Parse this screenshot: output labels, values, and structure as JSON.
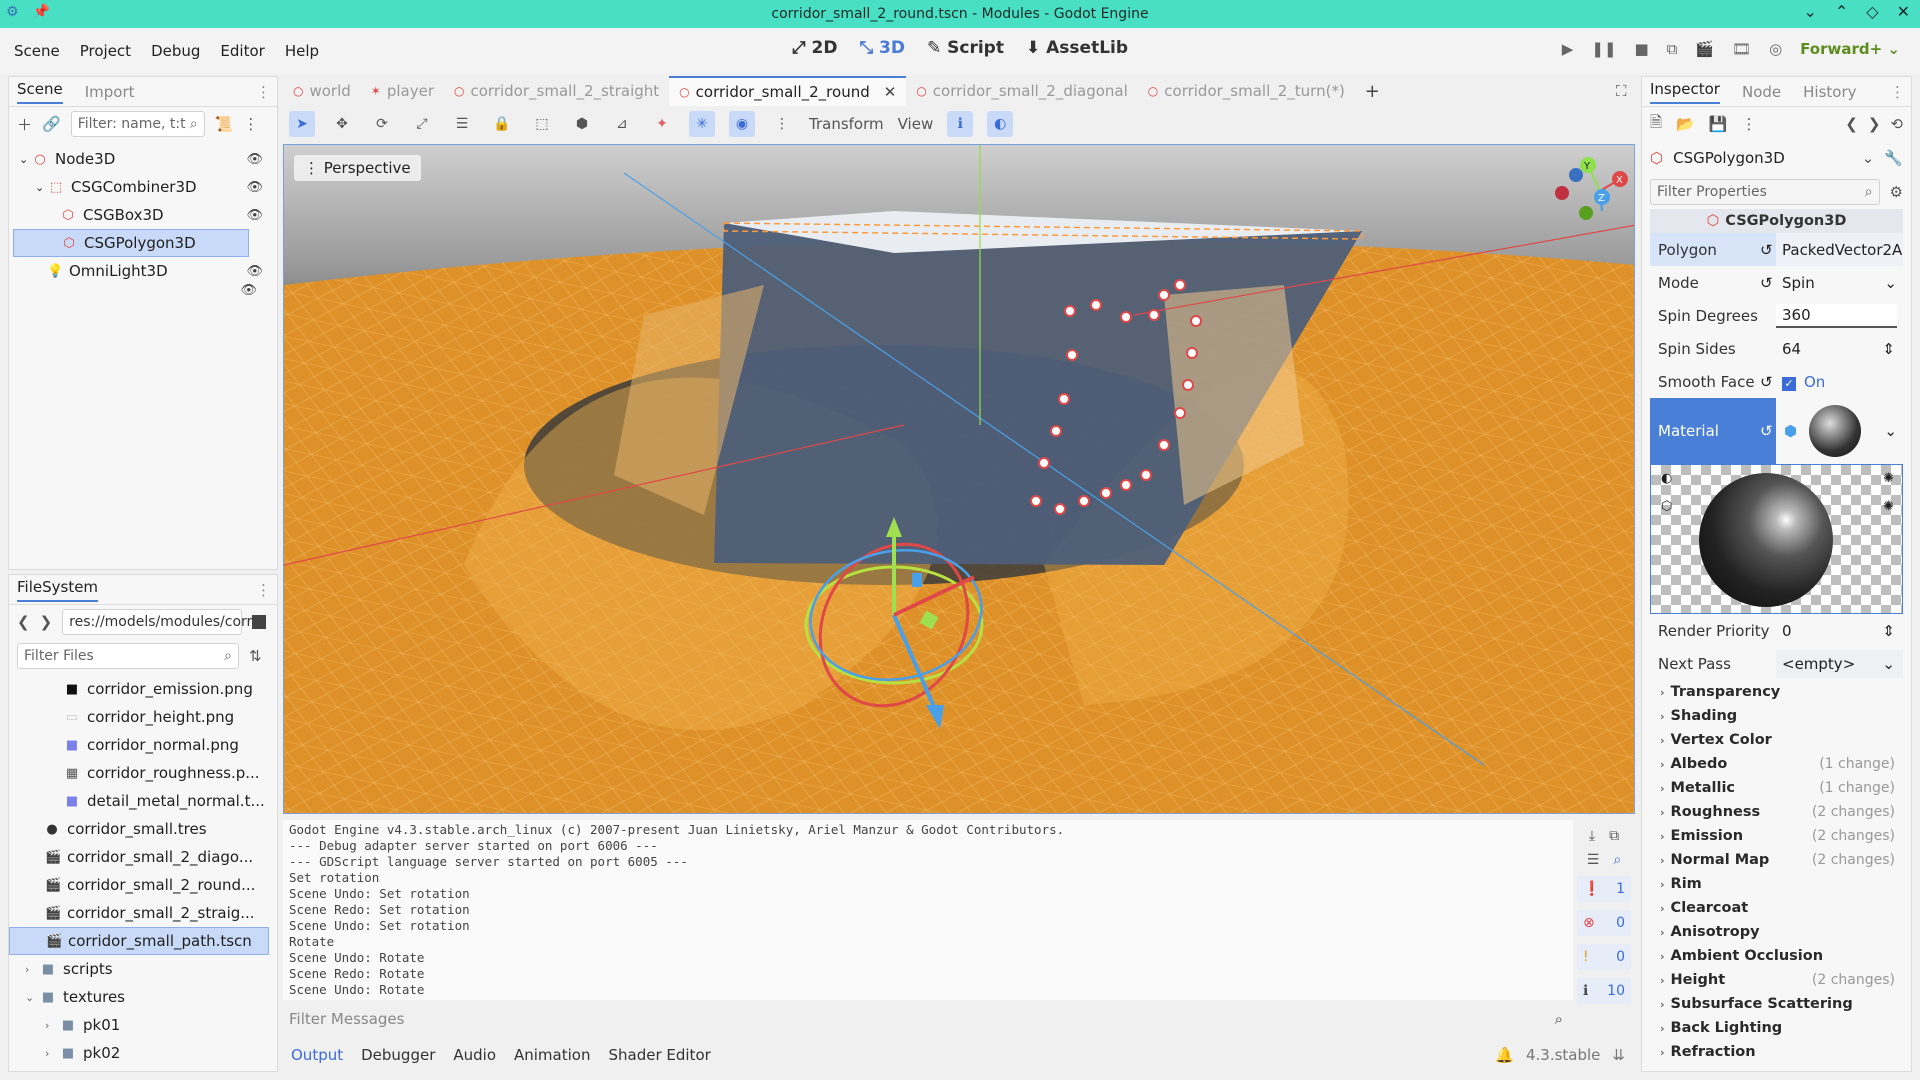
{
  "window": {
    "title": "corridor_small_2_round.tscn - Modules - Godot Engine",
    "controls": [
      "⌄",
      "⌃",
      "◇",
      "✕"
    ]
  },
  "menu": [
    "Scene",
    "Project",
    "Debug",
    "Editor",
    "Help"
  ],
  "workspaces": [
    {
      "label": "2D",
      "icon": "2d-icon"
    },
    {
      "label": "3D",
      "icon": "3d-icon"
    },
    {
      "label": "Script",
      "icon": "script-icon"
    },
    {
      "label": "AssetLib",
      "icon": "assetlib-icon"
    }
  ],
  "renderer": "Forward+",
  "scene_dock": {
    "tabs": [
      "Scene",
      "Import"
    ],
    "filter_placeholder": "Filter: name, t:t",
    "nodes": [
      {
        "label": "Node3D",
        "depth": 0
      },
      {
        "label": "CSGCombiner3D",
        "depth": 1
      },
      {
        "label": "CSGBox3D",
        "depth": 2
      },
      {
        "label": "CSGPolygon3D",
        "depth": 2,
        "selected": true
      },
      {
        "label": "OmniLight3D",
        "depth": 1
      }
    ]
  },
  "filesystem": {
    "tab": "FileSystem",
    "path": "res://models/modules/corri",
    "filter_placeholder": "Filter Files",
    "items": [
      {
        "label": "corridor_emission.png",
        "depth": 3,
        "icon": "black"
      },
      {
        "label": "corridor_height.png",
        "depth": 3,
        "icon": "white"
      },
      {
        "label": "corridor_normal.png",
        "depth": 3,
        "icon": "blue"
      },
      {
        "label": "corridor_roughness.p...",
        "depth": 3,
        "icon": "noise"
      },
      {
        "label": "detail_metal_normal.t...",
        "depth": 3,
        "icon": "blue"
      },
      {
        "label": "corridor_small.tres",
        "depth": 2,
        "icon": "sphere"
      },
      {
        "label": "corridor_small_2_diago...",
        "depth": 2,
        "icon": "scene"
      },
      {
        "label": "corridor_small_2_round...",
        "depth": 2,
        "icon": "scene"
      },
      {
        "label": "corridor_small_2_straig...",
        "depth": 2,
        "icon": "scene"
      },
      {
        "label": "corridor_small_path.tscn",
        "depth": 2,
        "icon": "scene",
        "selected": true
      },
      {
        "label": "scripts",
        "depth": 1,
        "icon": "folder"
      },
      {
        "label": "textures",
        "depth": 1,
        "icon": "folder",
        "open": true
      },
      {
        "label": "pk01",
        "depth": 2,
        "icon": "folder"
      },
      {
        "label": "pk02",
        "depth": 2,
        "icon": "folder"
      }
    ]
  },
  "editor_tabs": [
    {
      "label": "world"
    },
    {
      "label": "player"
    },
    {
      "label": "corridor_small_2_straight"
    },
    {
      "label": "corridor_small_2_round",
      "active": true
    },
    {
      "label": "corridor_small_2_diagonal"
    },
    {
      "label": "corridor_small_2_turn(*)"
    }
  ],
  "viewport_menu": {
    "transform": "Transform",
    "view": "View",
    "perspective": "Perspective"
  },
  "output": {
    "lines": [
      "Godot Engine v4.3.stable.arch_linux (c) 2007-present Juan Linietsky, Ariel Manzur & Godot Contributors.",
      "--- Debug adapter server started on port 6006 ---",
      "--- GDScript language server started on port 6005 ---",
      "Set rotation",
      "Scene Undo: Set rotation",
      "Scene Redo: Set rotation",
      "Scene Undo: Set rotation",
      "Rotate",
      "Scene Undo: Rotate",
      "Scene Redo: Rotate",
      "Scene Undo: Rotate"
    ],
    "filter_placeholder": "Filter Messages",
    "counts": {
      "messages": "1",
      "errors": "0",
      "warnings": "0",
      "info": "10"
    },
    "version": "4.3.stable"
  },
  "bottom_tabs": [
    "Output",
    "Debugger",
    "Audio",
    "Animation",
    "Shader Editor"
  ],
  "inspector": {
    "tabs": [
      "Inspector",
      "Node",
      "History"
    ],
    "object": "CSGPolygon3D",
    "filter_placeholder": "Filter Properties",
    "header": "CSGPolygon3D",
    "props": {
      "polygon_label": "Polygon",
      "polygon_value": "PackedVector2A",
      "mode_label": "Mode",
      "mode_value": "Spin",
      "spin_degrees_label": "Spin Degrees",
      "spin_degrees_value": "360",
      "spin_sides_label": "Spin Sides",
      "spin_sides_value": "64",
      "smooth_faces_label": "Smooth Face",
      "smooth_faces_value": "On",
      "material_label": "Material",
      "render_priority_label": "Render Priority",
      "render_priority_value": "0",
      "next_pass_label": "Next Pass",
      "next_pass_value": "<empty>"
    },
    "sections": [
      {
        "label": "Transparency",
        "changes": ""
      },
      {
        "label": "Shading",
        "changes": ""
      },
      {
        "label": "Vertex Color",
        "changes": ""
      },
      {
        "label": "Albedo",
        "changes": "(1 change)"
      },
      {
        "label": "Metallic",
        "changes": "(1 change)"
      },
      {
        "label": "Roughness",
        "changes": "(2 changes)"
      },
      {
        "label": "Emission",
        "changes": "(2 changes)"
      },
      {
        "label": "Normal Map",
        "changes": "(2 changes)"
      },
      {
        "label": "Rim",
        "changes": ""
      },
      {
        "label": "Clearcoat",
        "changes": ""
      },
      {
        "label": "Anisotropy",
        "changes": ""
      },
      {
        "label": "Ambient Occlusion",
        "changes": ""
      },
      {
        "label": "Height",
        "changes": "(2 changes)"
      },
      {
        "label": "Subsurface Scattering",
        "changes": ""
      },
      {
        "label": "Back Lighting",
        "changes": ""
      },
      {
        "label": "Refraction",
        "changes": ""
      }
    ]
  },
  "colors": {
    "accent": "#4a7fd8",
    "titlebar": "#48dfc4",
    "viewport_orange": "#e0962a"
  }
}
